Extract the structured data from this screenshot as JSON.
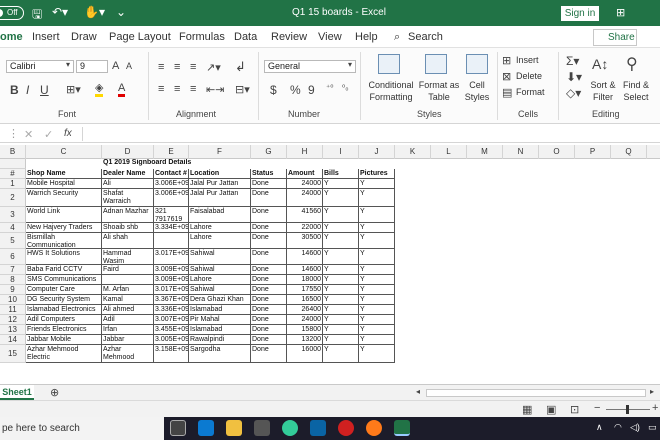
{
  "titlebar": {
    "autosave": "Off",
    "title": "Q1 15 boards  -  Excel",
    "search_placeholder": "Search",
    "signin": "Sign in"
  },
  "menu": [
    "ome",
    "Insert",
    "Draw",
    "Page Layout",
    "Formulas",
    "Data",
    "Review",
    "View",
    "Help"
  ],
  "search_label": "Search",
  "share": "Share",
  "ribbon": {
    "font_name": "Calibri",
    "font_size": "9",
    "grow_font": "A",
    "shrink_font": "A",
    "bold": "B",
    "italic": "I",
    "underline": "U",
    "number_format": "General",
    "currency": "$",
    "percent": "%",
    "comma": "9",
    "conditional_formatting": "Conditional Formatting",
    "format_as_table": "Format as Table",
    "cell_styles": "Cell Styles",
    "insert": "Insert",
    "delete": "Delete",
    "format": "Format",
    "sort_filter": "Sort & Filter",
    "find_select": "Find & Select",
    "groups": {
      "font": "Font",
      "alignment": "Alignment",
      "number": "Number",
      "styles": "Styles",
      "cells": "Cells",
      "editing": "Editing"
    }
  },
  "formula": {
    "fx": "fx"
  },
  "columns": [
    "B",
    "C",
    "D",
    "E",
    "F",
    "G",
    "H",
    "I",
    "J",
    "K",
    "L",
    "M",
    "N",
    "O",
    "P",
    "Q"
  ],
  "sheet": {
    "title": "Q1 2019 Signboard Details",
    "headers": [
      "#",
      "Shop Name",
      "Dealer Name",
      "Contact #",
      "Location",
      "Status",
      "Amount",
      "Bills",
      "Pictures"
    ],
    "rows": [
      [
        "1",
        "Mobile Hospital",
        "Ali",
        "3.006E+09",
        "Jalal Pur Jattan",
        "Done",
        "24000",
        "Y",
        "Y"
      ],
      [
        "2",
        "Warrich Security",
        "Shafat Warraich",
        "3.006E+09",
        "Jalal Pur Jattan",
        "Done",
        "24000",
        "Y",
        "Y"
      ],
      [
        "3",
        "World Link",
        "Adnan Mazhar",
        "321 7917619",
        "Faisalabad",
        "Done",
        "41560",
        "Y",
        "Y"
      ],
      [
        "4",
        "New Hajvery Traders",
        "Shoaib shb",
        "3.334E+09",
        "Lahore",
        "Done",
        "22000",
        "Y",
        "Y"
      ],
      [
        "5",
        "Bismillah Communication",
        "Ali shah",
        "",
        "Lahore",
        "Done",
        "30500",
        "Y",
        "Y"
      ],
      [
        "6",
        "HWS It Solutions",
        "Hammad Wasim",
        "3.017E+09",
        "Sahiwal",
        "Done",
        "14600",
        "Y",
        "Y"
      ],
      [
        "7",
        "Baba Farid CCTV",
        "Faird",
        "3.009E+09",
        "Sahiwal",
        "Done",
        "14600",
        "Y",
        "Y"
      ],
      [
        "8",
        "SMS Communications",
        "",
        "3.009E+09",
        "Lahore",
        "Done",
        "18000",
        "Y",
        "Y"
      ],
      [
        "9",
        "Computer Care",
        "M. Arfan",
        "3.017E+09",
        "Sahiwal",
        "Done",
        "17550",
        "Y",
        "Y"
      ],
      [
        "10",
        "DG Security System",
        "Kamal",
        "3.367E+09",
        "Dera Ghazi Khan",
        "Done",
        "16500",
        "Y",
        "Y"
      ],
      [
        "11",
        "Islamabad Electronics",
        "Ali ahmed",
        "3.336E+09",
        "Islamabad",
        "Done",
        "26400",
        "Y",
        "Y"
      ],
      [
        "12",
        "Adil Computers",
        "Adil",
        "3.007E+09",
        "Pir Mahal",
        "Done",
        "24000",
        "Y",
        "Y"
      ],
      [
        "13",
        "Friends Electronics",
        "Irfan",
        "3.455E+09",
        "Islamabad",
        "Done",
        "15800",
        "Y",
        "Y"
      ],
      [
        "14",
        "Jabbar Mobile",
        "Jabbar",
        "3.005E+09",
        "Rawalpindi",
        "Done",
        "13200",
        "Y",
        "Y"
      ],
      [
        "15",
        "Azhar Mehmood Electric",
        "Azhar Mehmood",
        "3.158E+09",
        "Sargodha",
        "Done",
        "16000",
        "Y",
        "Y"
      ]
    ],
    "row_headers": [
      "",
      "#",
      "1",
      "2",
      "3",
      "4",
      "5",
      "6",
      "7",
      "8",
      "9",
      "10",
      "11",
      "12",
      "13",
      "14",
      "15"
    ]
  },
  "sheet_tab": "Sheet1",
  "taskbar": {
    "search": "pe here to search"
  },
  "colors": {
    "excel_green": "#217346",
    "taskbar": "#1c1c2a"
  }
}
